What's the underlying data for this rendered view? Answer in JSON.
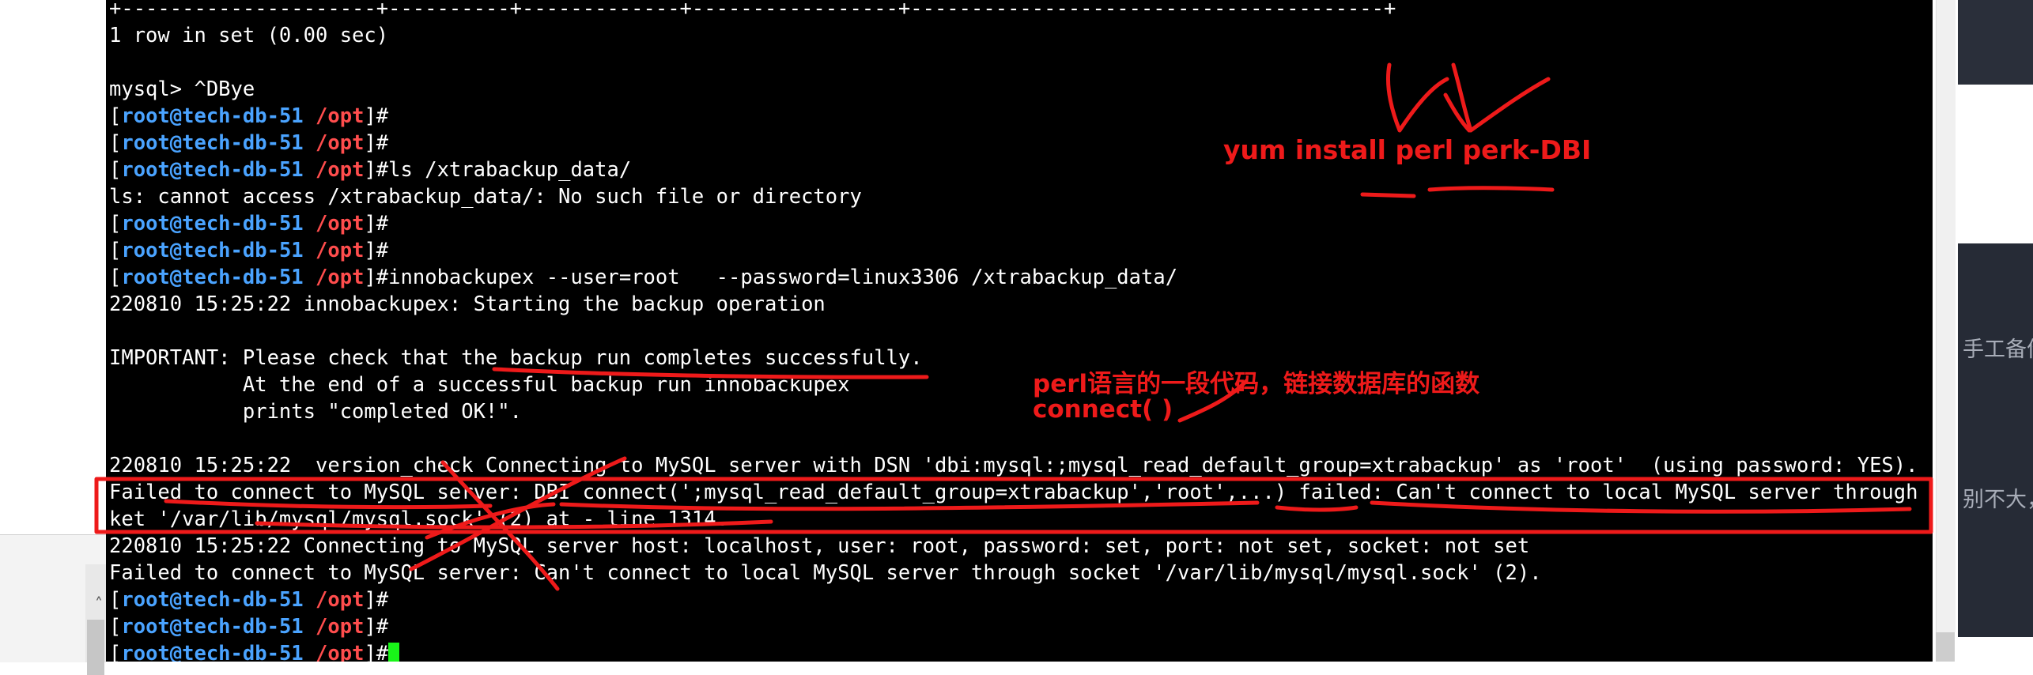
{
  "terminal": {
    "prompt": {
      "user": "root",
      "host": "tech-db-51",
      "dir": "/opt"
    },
    "lines": [
      {
        "type": "text",
        "text": "+---------------------+----------+-------------+-----------------+---------------------------------------+"
      },
      {
        "type": "text",
        "text": "1 row in set (0.00 sec)"
      },
      {
        "type": "text",
        "text": ""
      },
      {
        "type": "text",
        "text": "mysql> ^DBye"
      },
      {
        "type": "prompt",
        "cmd": ""
      },
      {
        "type": "prompt",
        "cmd": ""
      },
      {
        "type": "prompt",
        "cmd": "ls /xtrabackup_data/"
      },
      {
        "type": "text",
        "text": "ls: cannot access /xtrabackup_data/: No such file or directory"
      },
      {
        "type": "prompt",
        "cmd": ""
      },
      {
        "type": "prompt",
        "cmd": ""
      },
      {
        "type": "prompt",
        "cmd": "innobackupex --user=root   --password=linux3306 /xtrabackup_data/"
      },
      {
        "type": "text",
        "text": "220810 15:25:22 innobackupex: Starting the backup operation"
      },
      {
        "type": "text",
        "text": ""
      },
      {
        "type": "text",
        "text": "IMPORTANT: Please check that the backup run completes successfully."
      },
      {
        "type": "text",
        "text": "           At the end of a successful backup run innobackupex"
      },
      {
        "type": "text",
        "text": "           prints \"completed OK!\"."
      },
      {
        "type": "text",
        "text": ""
      },
      {
        "type": "text",
        "text": "220810 15:25:22  version_check Connecting to MySQL server with DSN 'dbi:mysql:;mysql_read_default_group=xtrabackup' as 'root'  (using password: YES)."
      },
      {
        "type": "text",
        "text": "Failed to connect to MySQL server: DBI connect(';mysql_read_default_group=xtrabackup','root',...) failed: Can't connect to local MySQL server through soc"
      },
      {
        "type": "text",
        "text": "ket '/var/lib/mysql/mysql.sock' (2) at - line 1314."
      },
      {
        "type": "text",
        "text": "220810 15:25:22 Connecting to MySQL server host: localhost, user: root, password: set, port: not set, socket: not set"
      },
      {
        "type": "text",
        "text": "Failed to connect to MySQL server: Can't connect to local MySQL server through socket '/var/lib/mysql/mysql.sock' (2)."
      },
      {
        "type": "prompt",
        "cmd": ""
      },
      {
        "type": "prompt",
        "cmd": ""
      },
      {
        "type": "prompt",
        "cmd": "",
        "cursor": true
      }
    ]
  },
  "annotations": {
    "yum_note": "yum install perl  perk-DBI",
    "perl_note_line1": "perl语言的一段代码，链接数据库的函数",
    "perl_note_line2": "connect( )",
    "color": "#ee1a1a"
  },
  "right_panel": {
    "snippet1": "手工备份",
    "snippet2": "别不大，"
  },
  "colors": {
    "terminal_bg": "#000000",
    "prompt_user_host": "#4aa3ff",
    "prompt_dir": "#5be84f",
    "cursor": "#19f519"
  }
}
